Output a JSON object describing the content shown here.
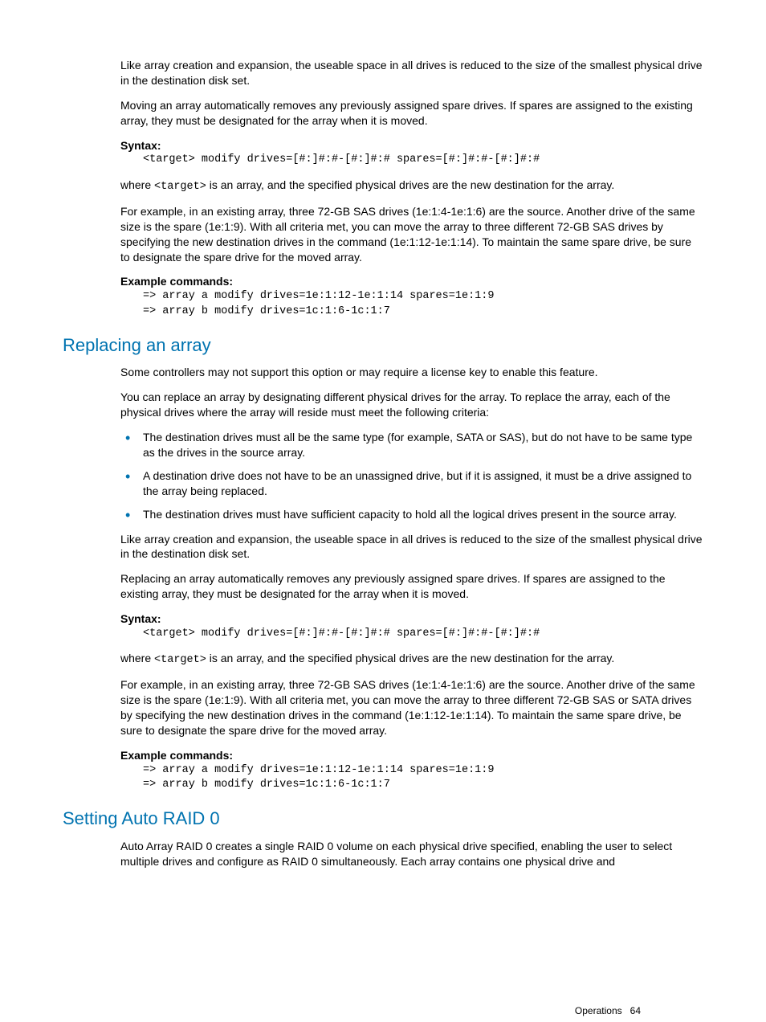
{
  "section1": {
    "p1": "Like array creation and expansion, the useable space in all drives is reduced to the size of the smallest physical drive in the destination disk set.",
    "p2": "Moving an array automatically removes any previously assigned spare drives. If spares are assigned to the existing array, they must be designated for the array when it is moved.",
    "syntax_label": "Syntax:",
    "syntax_code": "<target> modify drives=[#:]#:#-[#:]#:# spares=[#:]#:#-[#:]#:#",
    "where_pre": "where ",
    "where_code": "<target>",
    "where_post": " is an array, and the specified physical drives are the new destination for the array.",
    "p3": "For example, in an existing array, three 72-GB SAS drives (1e:1:4-1e:1:6) are the source. Another drive of the same size is the spare (1e:1:9). With all criteria met, you can move the array to three different 72-GB SAS drives by specifying the new destination drives in the command (1e:1:12-1e:1:14). To maintain the same spare drive, be sure to designate the spare drive for the moved array.",
    "example_label": "Example commands:",
    "example_code": "=> array a modify drives=1e:1:12-1e:1:14 spares=1e:1:9\n=> array b modify drives=1c:1:6-1c:1:7"
  },
  "section2": {
    "heading": "Replacing an array",
    "p1": "Some controllers may not support this option or may require a license key to enable this feature.",
    "p2": "You can replace an array by designating different physical drives for the array. To replace the array, each of the physical drives where the array will reside must meet the following criteria:",
    "bullets": [
      "The destination drives must all be the same type (for example, SATA or SAS), but do not have to be same type as the drives in the source array.",
      "A destination drive does not have to be an unassigned drive, but if it is assigned, it must be a drive assigned to the array being replaced.",
      "The destination drives must have sufficient capacity to hold all the logical drives present in the source array."
    ],
    "p3": "Like array creation and expansion, the useable space in all drives is reduced to the size of the smallest physical drive in the destination disk set.",
    "p4": "Replacing an array automatically removes any previously assigned spare drives. If spares are assigned to the existing array, they must be designated for the array when it is moved.",
    "syntax_label": "Syntax:",
    "syntax_code": "<target> modify drives=[#:]#:#-[#:]#:# spares=[#:]#:#-[#:]#:#",
    "where_pre": "where ",
    "where_code": "<target>",
    "where_post": " is an array, and the specified physical drives are the new destination for the array.",
    "p5": "For example, in an existing array, three 72-GB SAS drives (1e:1:4-1e:1:6) are the source. Another drive of the same size is the spare (1e:1:9). With all criteria met, you can move the array to three different 72-GB SAS or SATA drives by specifying the new destination drives in the command (1e:1:12-1e:1:14). To maintain the same spare drive, be sure to designate the spare drive for the moved array.",
    "example_label": "Example commands:",
    "example_code": "=> array a modify drives=1e:1:12-1e:1:14 spares=1e:1:9\n=> array b modify drives=1c:1:6-1c:1:7"
  },
  "section3": {
    "heading": "Setting Auto RAID 0",
    "p1": "Auto Array RAID 0 creates a single RAID 0 volume on each physical drive specified, enabling the user to select multiple drives and configure as RAID 0 simultaneously. Each array contains one physical drive and"
  },
  "footer": {
    "label": "Operations",
    "page": "64"
  }
}
